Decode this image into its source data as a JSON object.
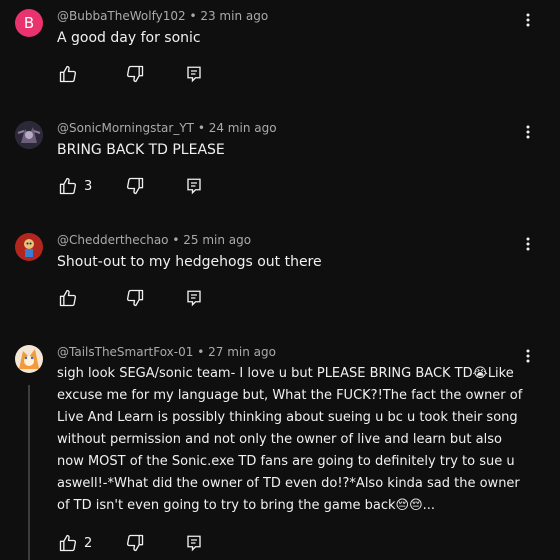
{
  "comments": [
    {
      "avatar_letter": "B",
      "author": "@BubbaTheWolfy102",
      "time": "23 min ago",
      "text": "A good day for sonic",
      "likes": ""
    },
    {
      "avatar_letter": "",
      "author": "@SonicMorningstar_YT",
      "time": "24 min ago",
      "text": "BRING BACK TD PLEASE",
      "likes": "3"
    },
    {
      "avatar_letter": "",
      "author": "@Chedderthechao",
      "time": "25 min ago",
      "text": "Shout-out to my hedgehogs out there",
      "likes": ""
    },
    {
      "avatar_letter": "",
      "author": "@TailsTheSmartFox-01",
      "time": "27 min ago",
      "text_lines": [
        "sigh look SEGA/sonic team- I love u but PLEASE BRING BACK TD😭Like",
        "excuse me for my language but, What the FUCK?!The fact the owner of",
        "Live And Learn is possibly thinking about sueing u bc u took their song",
        "without permission and not only the owner of live and learn but also",
        "now MOST of the  Sonic.exe TD fans are going to definitely try to sue u",
        "aswell!-*What did the owner of TD even do!?*Also kinda sad the owner",
        "of TD isn't even going to try to bring the game back😔😔..."
      ],
      "likes": "2"
    }
  ],
  "separator": "•",
  "colors": {
    "background": "#0f0f0f",
    "text": "#f1f1f1",
    "meta": "#aaaaaa",
    "avatar_b": "#e8336e"
  }
}
